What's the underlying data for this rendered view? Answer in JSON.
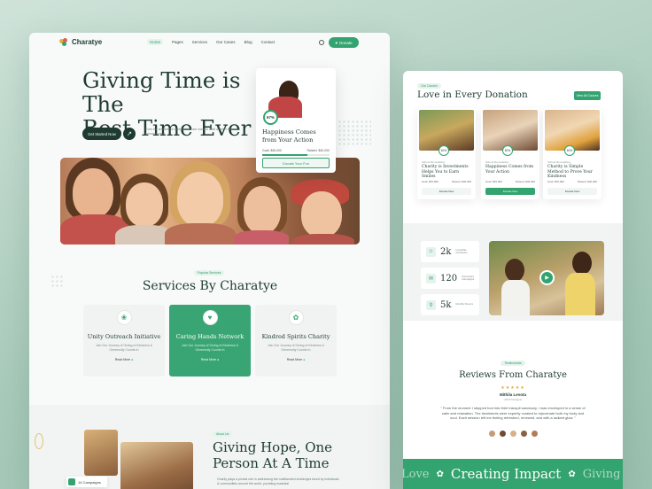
{
  "colors": {
    "accent": "#33a36f",
    "dark": "#1e3a31",
    "bg": "#a9cbbb"
  },
  "left": {
    "brand": "Charatye",
    "menu": [
      "Home",
      "Pages",
      "Services",
      "Our Cases",
      "Blog",
      "Contact"
    ],
    "donate_label": "Donate",
    "hero_title_line1": "Giving Time is The",
    "hero_title_line2": "Best Time Ever",
    "hero_text": "Even the smallest of contributions are used to build a better future for tomorrow deal.",
    "cta_label": "Get Started Now",
    "hero_card": {
      "percent": "67%",
      "title": "Happiness Comes from Your Action",
      "goal": "Goal: $45,000",
      "raised": "Raised: $40,000",
      "raised_fraction": 0.67,
      "button": "Donate Your Fun"
    },
    "services_tag": "Popular Services",
    "services_title": "Services By Charatye",
    "services": [
      {
        "title": "Unity Outreach Initiative",
        "text": "Join Our Journey of Giving of Kindness & Generosity Counts In",
        "link": "Read More",
        "icon": "hands-heart-icon"
      },
      {
        "title": "Caring Hands Network",
        "text": "Join Our Journey of Giving of Kindness & Generosity Counts In",
        "link": "Read More",
        "icon": "heart-hand-icon"
      },
      {
        "title": "Kindred Spirits Charity",
        "text": "Join Our Journey of Giving of Kindness & Generosity Counts In",
        "link": "Read More",
        "icon": "gift-icon"
      }
    ],
    "about_tag": "About Us",
    "about_title_line1": "Giving Hope, One",
    "about_title_line2": "Person At A Time",
    "about_text": "Charity plays a pivotal role in addressing the multifaceted challenges faced by individuals & communities around the world, providing essential",
    "campaigns_badge": "14 Campaigns"
  },
  "right": {
    "donation_tag": "Our Causes",
    "donation_title": "Love in Every Donation",
    "view_all": "View All Causes",
    "cards": [
      {
        "percent": "60%",
        "category": "School Remodeling",
        "title": "Charity is Investments Helps You to Earn Smiles",
        "goal": "Goal: $45,000",
        "raised": "Raised: $40,000",
        "button": "Donate Now"
      },
      {
        "percent": "80%",
        "category": "School Remodeling",
        "title": "Happiness Comes from Your Action",
        "goal": "Goal: $45,000",
        "raised": "Raised: $40,000",
        "button": "Donate Now"
      },
      {
        "percent": "60%",
        "category": "School Remodeling",
        "title": "Charity is Simple Method to Prove Your Kindness",
        "goal": "Goal: $45,000",
        "raised": "Raised: $40,000",
        "button": "Donate Now"
      }
    ],
    "stats": [
      {
        "value": "2k",
        "label": "Incredible Volunteers",
        "icon": "people-icon"
      },
      {
        "value": "120",
        "label": "Successful Campaigns",
        "icon": "campaign-icon"
      },
      {
        "value": "5k",
        "label": "Monthly Donors",
        "icon": "location-icon"
      }
    ],
    "reviews_tag": "Testimonials",
    "reviews_title": "Reviews From Charatye",
    "stars": "★★★★★",
    "reviewer": "Mithila Levota",
    "reviewer_role": "UI/UX Designer",
    "quote": "\" From the moment I stepped foot into their tranquil sanctuary, I was enveloped in a sense of calm and relaxation. The treatments were expertly curated to rejuvenate both my body and soul. Each session left me feeling refreshed, renewed, and with a radiant glow. \"",
    "ribbon": [
      "Love",
      "Creating Impact",
      "Giving"
    ]
  }
}
